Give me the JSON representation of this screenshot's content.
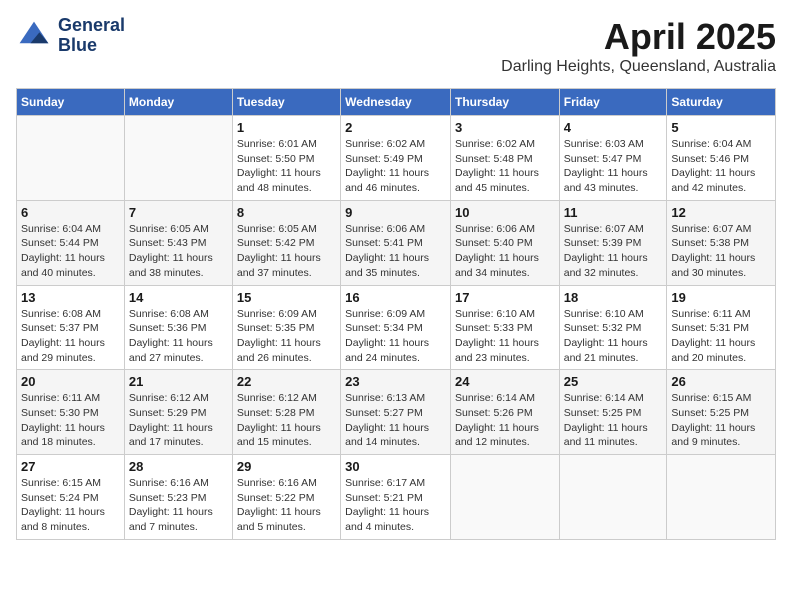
{
  "header": {
    "logo_line1": "General",
    "logo_line2": "Blue",
    "month_title": "April 2025",
    "location": "Darling Heights, Queensland, Australia"
  },
  "days_of_week": [
    "Sunday",
    "Monday",
    "Tuesday",
    "Wednesday",
    "Thursday",
    "Friday",
    "Saturday"
  ],
  "weeks": [
    [
      {
        "day": "",
        "detail": ""
      },
      {
        "day": "",
        "detail": ""
      },
      {
        "day": "1",
        "detail": "Sunrise: 6:01 AM\nSunset: 5:50 PM\nDaylight: 11 hours\nand 48 minutes."
      },
      {
        "day": "2",
        "detail": "Sunrise: 6:02 AM\nSunset: 5:49 PM\nDaylight: 11 hours\nand 46 minutes."
      },
      {
        "day": "3",
        "detail": "Sunrise: 6:02 AM\nSunset: 5:48 PM\nDaylight: 11 hours\nand 45 minutes."
      },
      {
        "day": "4",
        "detail": "Sunrise: 6:03 AM\nSunset: 5:47 PM\nDaylight: 11 hours\nand 43 minutes."
      },
      {
        "day": "5",
        "detail": "Sunrise: 6:04 AM\nSunset: 5:46 PM\nDaylight: 11 hours\nand 42 minutes."
      }
    ],
    [
      {
        "day": "6",
        "detail": "Sunrise: 6:04 AM\nSunset: 5:44 PM\nDaylight: 11 hours\nand 40 minutes."
      },
      {
        "day": "7",
        "detail": "Sunrise: 6:05 AM\nSunset: 5:43 PM\nDaylight: 11 hours\nand 38 minutes."
      },
      {
        "day": "8",
        "detail": "Sunrise: 6:05 AM\nSunset: 5:42 PM\nDaylight: 11 hours\nand 37 minutes."
      },
      {
        "day": "9",
        "detail": "Sunrise: 6:06 AM\nSunset: 5:41 PM\nDaylight: 11 hours\nand 35 minutes."
      },
      {
        "day": "10",
        "detail": "Sunrise: 6:06 AM\nSunset: 5:40 PM\nDaylight: 11 hours\nand 34 minutes."
      },
      {
        "day": "11",
        "detail": "Sunrise: 6:07 AM\nSunset: 5:39 PM\nDaylight: 11 hours\nand 32 minutes."
      },
      {
        "day": "12",
        "detail": "Sunrise: 6:07 AM\nSunset: 5:38 PM\nDaylight: 11 hours\nand 30 minutes."
      }
    ],
    [
      {
        "day": "13",
        "detail": "Sunrise: 6:08 AM\nSunset: 5:37 PM\nDaylight: 11 hours\nand 29 minutes."
      },
      {
        "day": "14",
        "detail": "Sunrise: 6:08 AM\nSunset: 5:36 PM\nDaylight: 11 hours\nand 27 minutes."
      },
      {
        "day": "15",
        "detail": "Sunrise: 6:09 AM\nSunset: 5:35 PM\nDaylight: 11 hours\nand 26 minutes."
      },
      {
        "day": "16",
        "detail": "Sunrise: 6:09 AM\nSunset: 5:34 PM\nDaylight: 11 hours\nand 24 minutes."
      },
      {
        "day": "17",
        "detail": "Sunrise: 6:10 AM\nSunset: 5:33 PM\nDaylight: 11 hours\nand 23 minutes."
      },
      {
        "day": "18",
        "detail": "Sunrise: 6:10 AM\nSunset: 5:32 PM\nDaylight: 11 hours\nand 21 minutes."
      },
      {
        "day": "19",
        "detail": "Sunrise: 6:11 AM\nSunset: 5:31 PM\nDaylight: 11 hours\nand 20 minutes."
      }
    ],
    [
      {
        "day": "20",
        "detail": "Sunrise: 6:11 AM\nSunset: 5:30 PM\nDaylight: 11 hours\nand 18 minutes."
      },
      {
        "day": "21",
        "detail": "Sunrise: 6:12 AM\nSunset: 5:29 PM\nDaylight: 11 hours\nand 17 minutes."
      },
      {
        "day": "22",
        "detail": "Sunrise: 6:12 AM\nSunset: 5:28 PM\nDaylight: 11 hours\nand 15 minutes."
      },
      {
        "day": "23",
        "detail": "Sunrise: 6:13 AM\nSunset: 5:27 PM\nDaylight: 11 hours\nand 14 minutes."
      },
      {
        "day": "24",
        "detail": "Sunrise: 6:14 AM\nSunset: 5:26 PM\nDaylight: 11 hours\nand 12 minutes."
      },
      {
        "day": "25",
        "detail": "Sunrise: 6:14 AM\nSunset: 5:25 PM\nDaylight: 11 hours\nand 11 minutes."
      },
      {
        "day": "26",
        "detail": "Sunrise: 6:15 AM\nSunset: 5:25 PM\nDaylight: 11 hours\nand 9 minutes."
      }
    ],
    [
      {
        "day": "27",
        "detail": "Sunrise: 6:15 AM\nSunset: 5:24 PM\nDaylight: 11 hours\nand 8 minutes."
      },
      {
        "day": "28",
        "detail": "Sunrise: 6:16 AM\nSunset: 5:23 PM\nDaylight: 11 hours\nand 7 minutes."
      },
      {
        "day": "29",
        "detail": "Sunrise: 6:16 AM\nSunset: 5:22 PM\nDaylight: 11 hours\nand 5 minutes."
      },
      {
        "day": "30",
        "detail": "Sunrise: 6:17 AM\nSunset: 5:21 PM\nDaylight: 11 hours\nand 4 minutes."
      },
      {
        "day": "",
        "detail": ""
      },
      {
        "day": "",
        "detail": ""
      },
      {
        "day": "",
        "detail": ""
      }
    ]
  ]
}
